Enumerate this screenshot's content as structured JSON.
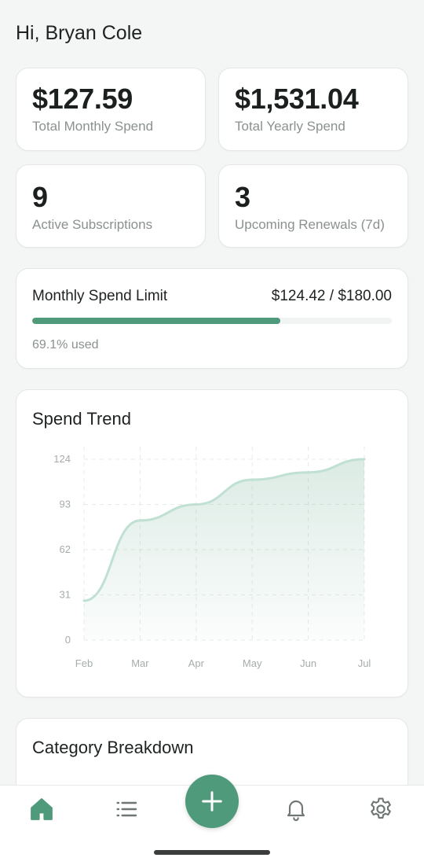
{
  "greeting": "Hi, Bryan Cole",
  "stats": [
    {
      "value": "$127.59",
      "label": "Total Monthly Spend"
    },
    {
      "value": "$1,531.04",
      "label": "Total Yearly Spend"
    },
    {
      "value": "9",
      "label": "Active Subscriptions"
    },
    {
      "value": "3",
      "label": "Upcoming Renewals (7d)"
    }
  ],
  "limit": {
    "title": "Monthly Spend Limit",
    "amount": "$124.42 / $180.00",
    "used_fraction": 0.691,
    "used_text": "69.1% used"
  },
  "trend": {
    "title": "Spend Trend"
  },
  "chart_data": {
    "type": "area",
    "title": "Spend Trend",
    "x": [
      "Feb",
      "Mar",
      "Apr",
      "May",
      "Jun",
      "Jul"
    ],
    "series": [
      {
        "values": [
          27,
          82,
          93,
          110,
          115,
          124
        ]
      }
    ],
    "y_ticks": [
      "124",
      "93",
      "62",
      "31",
      "0"
    ],
    "ylim": [
      0,
      124
    ],
    "grid": true,
    "color": "#4f9a7a"
  },
  "category": {
    "title": "Category Breakdown"
  },
  "nav": {
    "items": [
      "home-icon",
      "list-icon",
      "plus-icon",
      "bell-icon",
      "gear-icon"
    ],
    "active_color": "#4f9a7a",
    "inactive_color": "#6f7673"
  }
}
